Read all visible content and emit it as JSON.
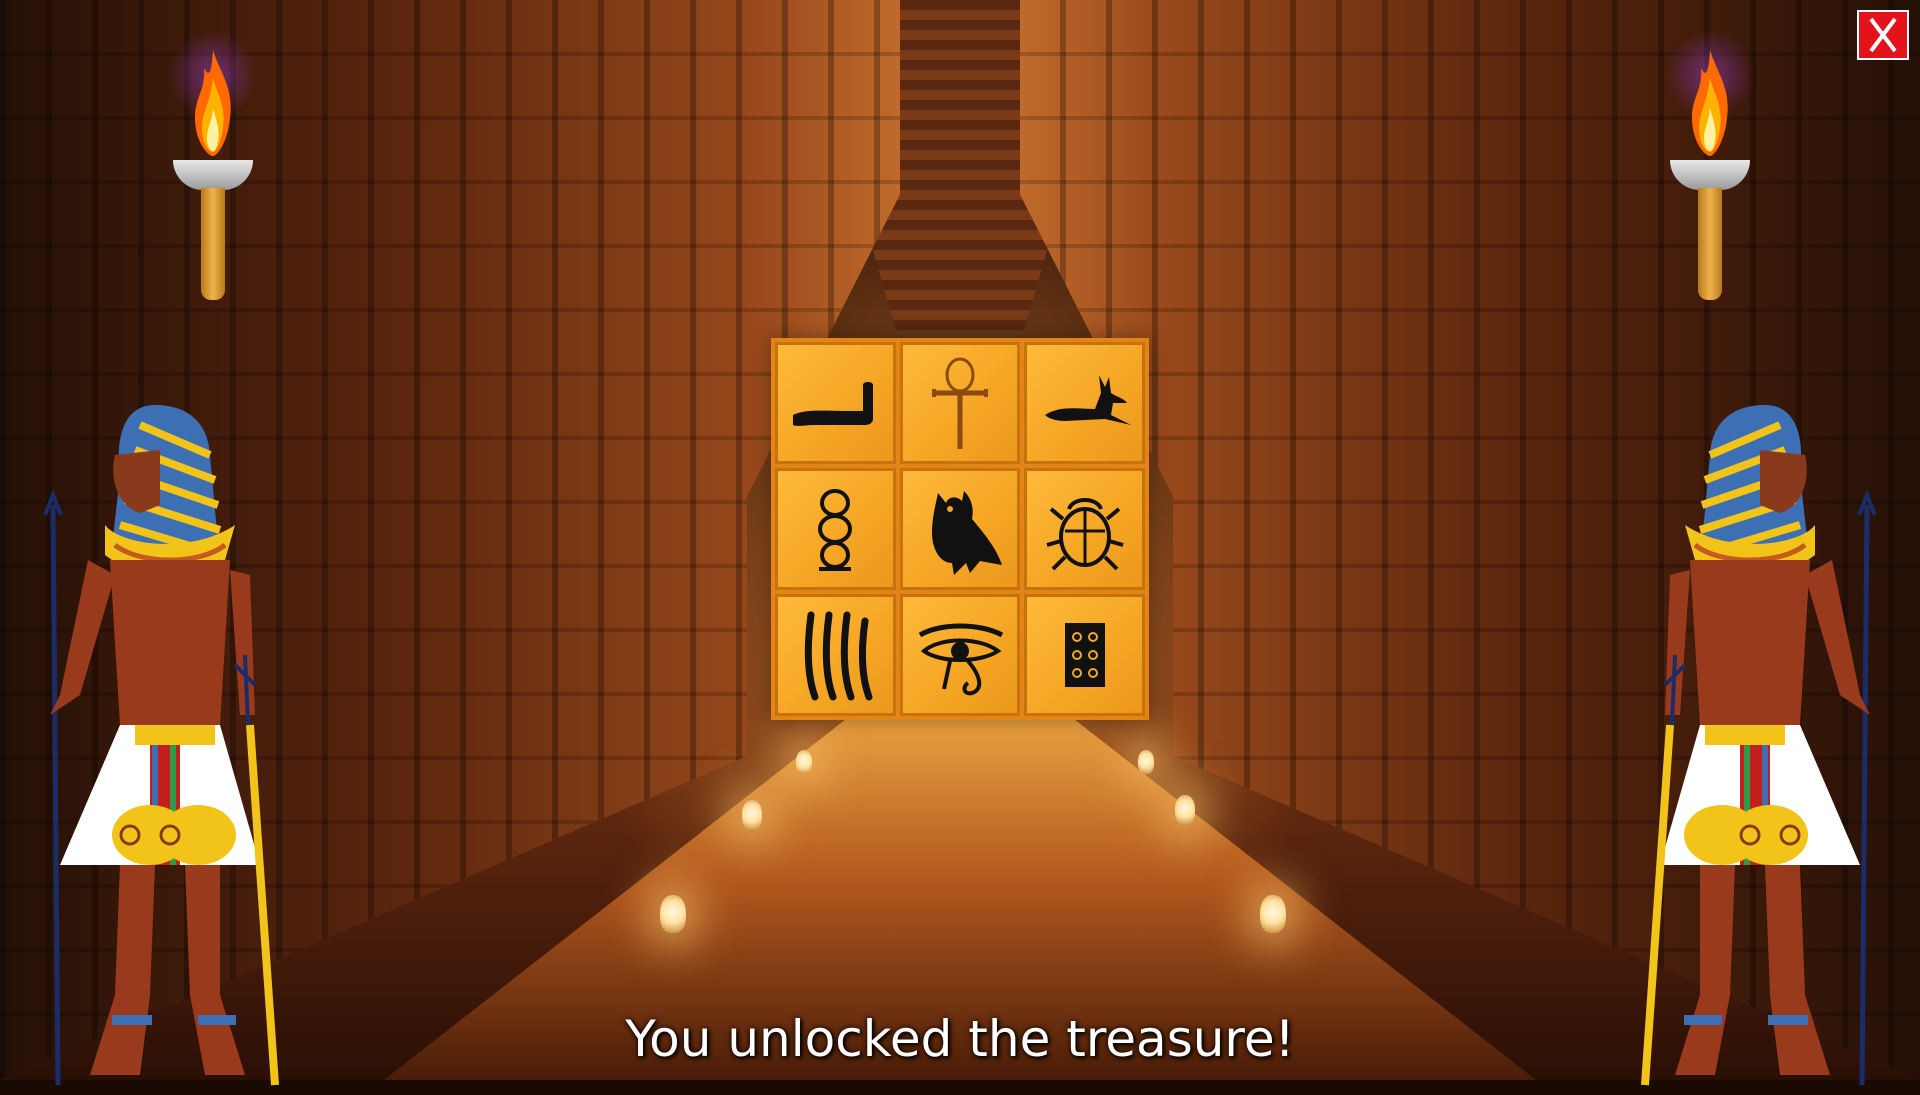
{
  "game": {
    "message": "You unlocked the treasure!",
    "close_button_label": "X",
    "close_button_color": "#e4121a",
    "grid_color": "#e38416",
    "tile_color": "#f5a524"
  },
  "puzzle": {
    "tiles": [
      {
        "icon": "forearm-hieroglyph-icon"
      },
      {
        "icon": "ankh-icon"
      },
      {
        "icon": "anubis-jackal-icon"
      },
      {
        "icon": "coil-rope-icon"
      },
      {
        "icon": "owl-icon"
      },
      {
        "icon": "scarab-icon"
      },
      {
        "icon": "reed-strokes-icon"
      },
      {
        "icon": "eye-of-horus-icon"
      },
      {
        "icon": "dice-panel-icon"
      }
    ]
  },
  "decor": {
    "torches": [
      "torch-left",
      "torch-right"
    ],
    "pharaohs": [
      "pharaoh-left",
      "pharaoh-right"
    ]
  }
}
